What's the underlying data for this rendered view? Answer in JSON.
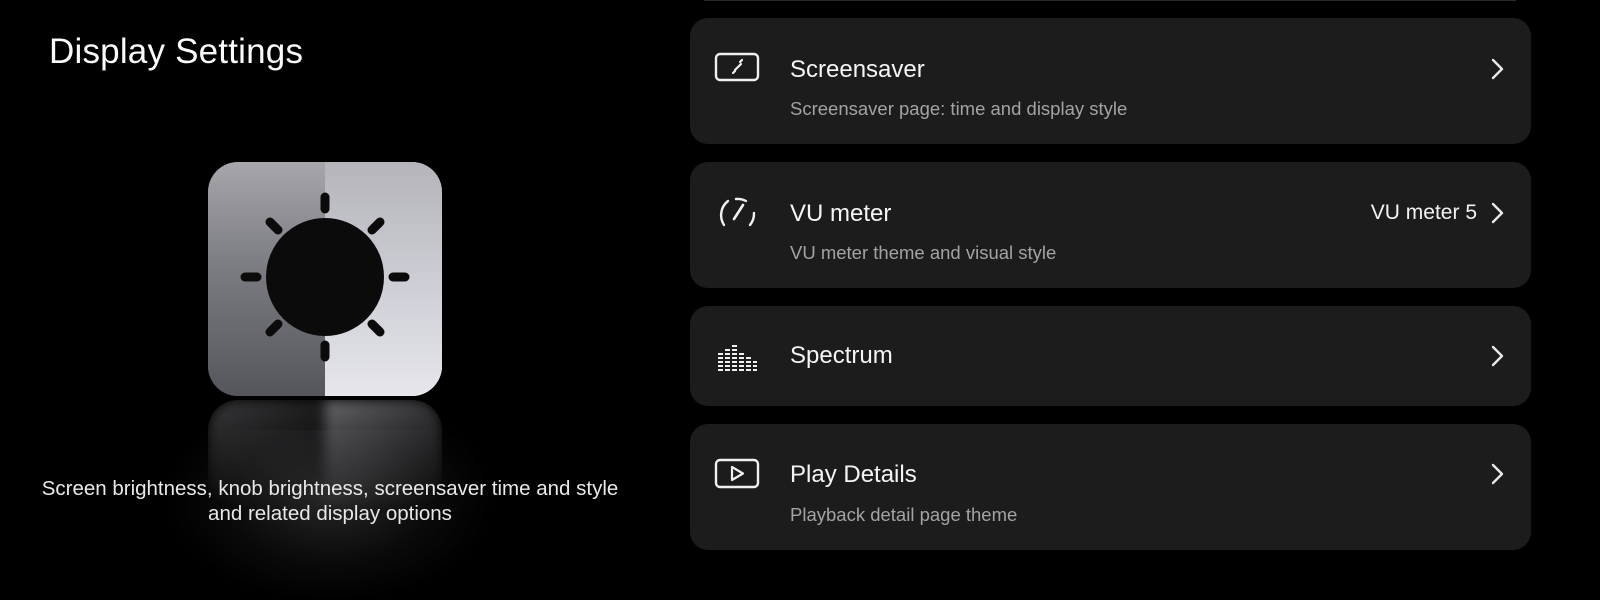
{
  "page": {
    "title": "Display Settings",
    "description": "Screen brightness, knob brightness, screensaver time and style and related display options",
    "hero_icon": "brightness-sun-icon"
  },
  "settings": [
    {
      "title": "Screensaver",
      "subtitle": "Screensaver page: time and display style",
      "value": "",
      "icon": "screensaver-icon"
    },
    {
      "title": "VU meter",
      "subtitle": "VU meter theme and visual style",
      "value": "VU meter 5",
      "icon": "vu-meter-icon"
    },
    {
      "title": "Spectrum",
      "subtitle": "",
      "value": "",
      "icon": "spectrum-icon"
    },
    {
      "title": "Play Details",
      "subtitle": "Playback detail page theme",
      "value": "",
      "icon": "play-icon"
    }
  ],
  "colors": {
    "background": "#000000",
    "card": "#1c1c1c",
    "text": "#f5f5f5",
    "subtext": "#a3a3a3"
  }
}
